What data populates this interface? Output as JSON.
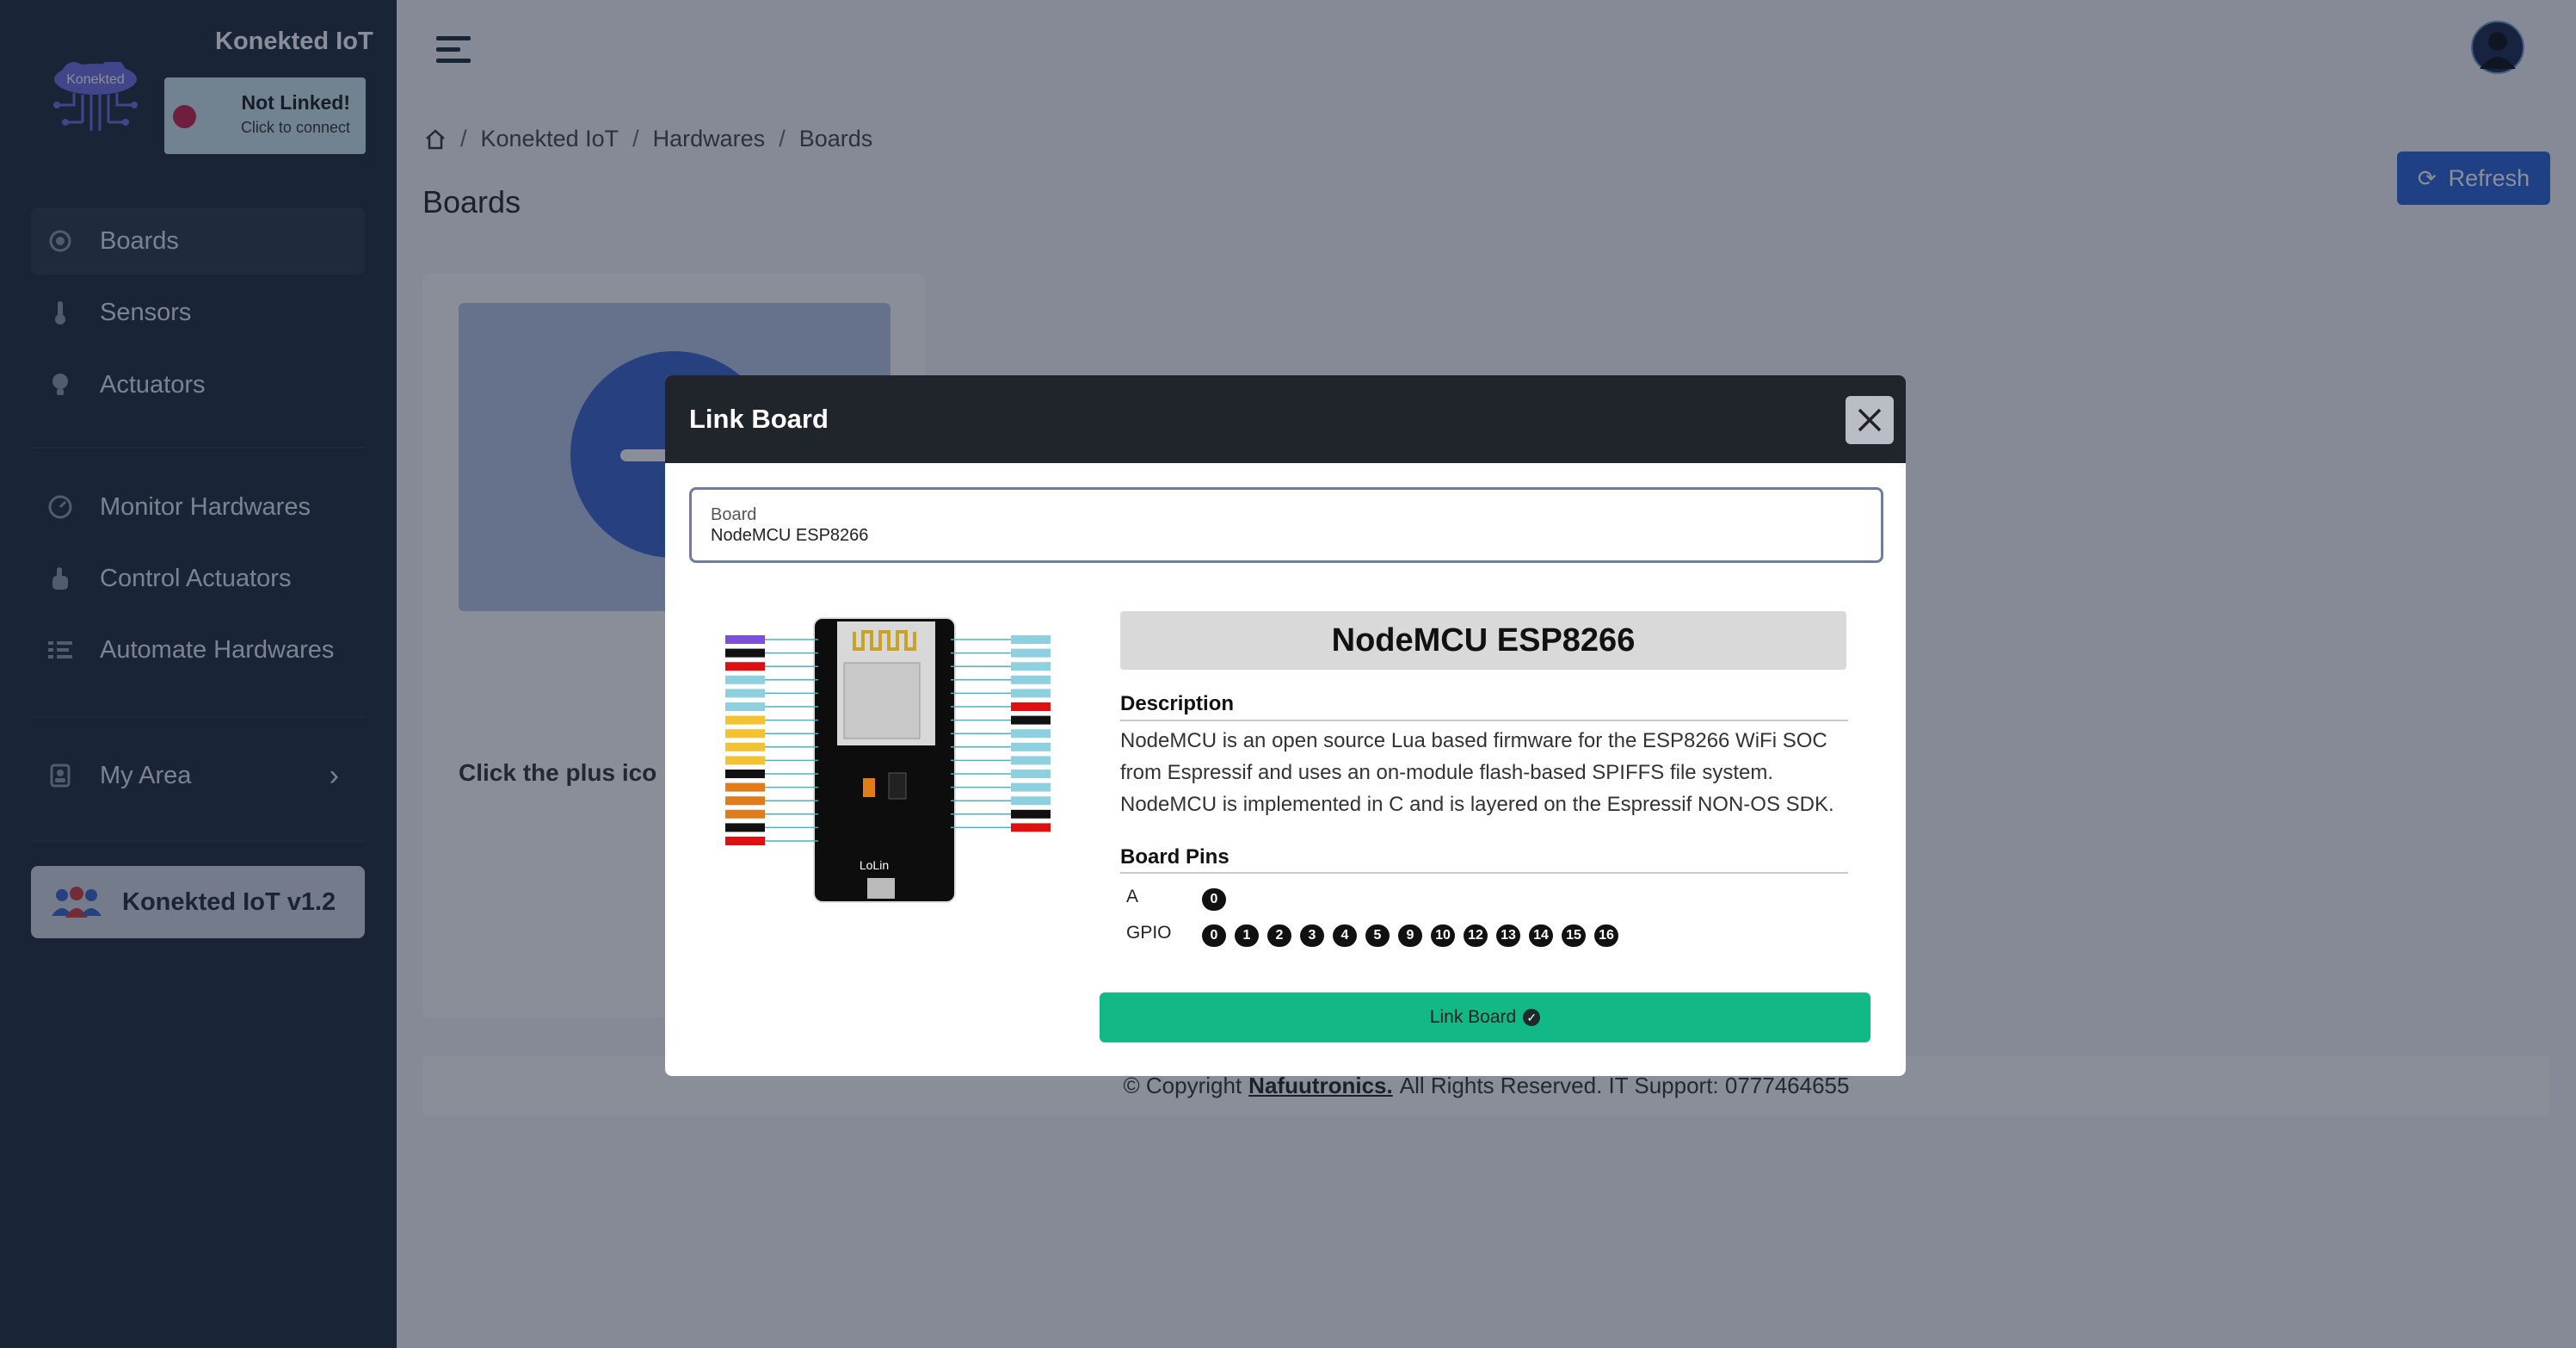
{
  "app": {
    "title": "Konekted IoT",
    "logo_text": "Konekted"
  },
  "link_status": {
    "title": "Not Linked!",
    "subtitle": "Click to connect",
    "color": "#cc1e4a"
  },
  "sidebar": {
    "items": [
      {
        "label": "Boards",
        "icon": "chip-icon"
      },
      {
        "label": "Sensors",
        "icon": "thermometer-icon"
      },
      {
        "label": "Actuators",
        "icon": "lightbulb-icon"
      },
      {
        "label": "Monitor Hardwares",
        "icon": "gauge-icon"
      },
      {
        "label": "Control Actuators",
        "icon": "hand-pointer-icon"
      },
      {
        "label": "Automate Hardwares",
        "icon": "list-settings-icon"
      },
      {
        "label": "My Area",
        "icon": "user-badge-icon"
      }
    ],
    "version": "Konekted IoT v1.2"
  },
  "breadcrumb": [
    "Konekted IoT",
    "Hardwares",
    "Boards"
  ],
  "page": {
    "title": "Boards",
    "refresh_label": "Refresh",
    "card_text": "Click the plus ico"
  },
  "footer": {
    "prefix": "© Copyright",
    "company": "Nafuutronics.",
    "suffix": "All Rights Reserved. IT Support: 0777464655"
  },
  "modal": {
    "title": "Link Board",
    "field_label": "Board",
    "field_value": "NodeMCU ESP8266",
    "board_name": "NodeMCU ESP8266",
    "description_title": "Description",
    "description": "NodeMCU is an open source Lua based firmware for the ESP8266 WiFi SOC from Espressif and uses an on-module flash-based SPIFFS file system. NodeMCU is implemented in C and is layered on the Espressif NON-OS SDK.",
    "pins_title": "Board Pins",
    "pins": {
      "analog_label": "A",
      "analog": [
        "0"
      ],
      "gpio_label": "GPIO",
      "gpio": [
        "0",
        "1",
        "2",
        "3",
        "4",
        "5",
        "9",
        "10",
        "12",
        "13",
        "14",
        "15",
        "16"
      ]
    },
    "link_button": "Link Board",
    "board_silkscreen": "LoLin"
  },
  "colors": {
    "sidebar": "#1f2a3c",
    "primary": "#2d63d8",
    "success": "#12b886",
    "modal_header": "#20242b"
  }
}
